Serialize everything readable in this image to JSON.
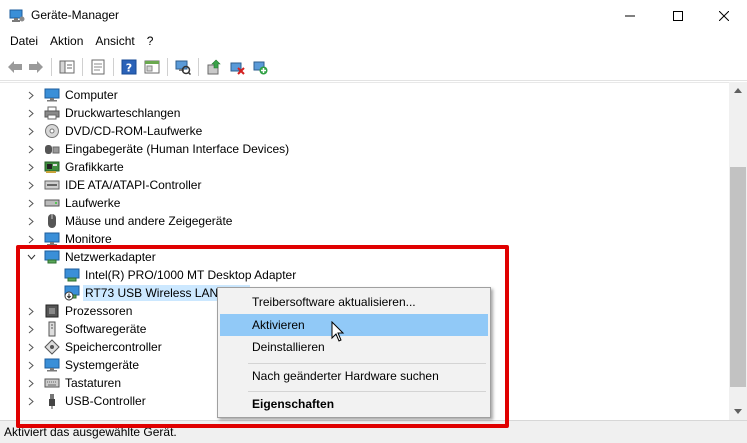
{
  "window": {
    "title": "Geräte-Manager",
    "icon": "device-manager-icon"
  },
  "menubar": {
    "items": [
      "Datei",
      "Aktion",
      "Ansicht",
      "?"
    ]
  },
  "toolbar": {
    "icons": [
      "back-arrow-icon",
      "forward-arrow-icon",
      "show-hide-icon",
      "properties-icon",
      "help-icon",
      "console-tree-icon",
      "scan-hardware-icon",
      "update-driver-icon",
      "uninstall-icon",
      "enable-device-icon"
    ]
  },
  "tree": {
    "items": [
      {
        "label": "Computer",
        "icon": "computer-icon",
        "expanded": false,
        "level": 0
      },
      {
        "label": "Druckwarteschlangen",
        "icon": "printer-icon",
        "expanded": false,
        "level": 0
      },
      {
        "label": "DVD/CD-ROM-Laufwerke",
        "icon": "dvd-icon",
        "expanded": false,
        "level": 0
      },
      {
        "label": "Eingabegeräte (Human Interface Devices)",
        "icon": "hid-icon",
        "expanded": false,
        "level": 0
      },
      {
        "label": "Grafikkarte",
        "icon": "graphics-card-icon",
        "expanded": false,
        "level": 0
      },
      {
        "label": "IDE ATA/ATAPI-Controller",
        "icon": "ide-controller-icon",
        "expanded": false,
        "level": 0
      },
      {
        "label": "Laufwerke",
        "icon": "disk-drive-icon",
        "expanded": false,
        "level": 0
      },
      {
        "label": "Mäuse und andere Zeigegeräte",
        "icon": "mouse-icon",
        "expanded": false,
        "level": 0
      },
      {
        "label": "Monitore",
        "icon": "monitor-icon",
        "expanded": false,
        "level": 0
      },
      {
        "label": "Netzwerkadapter",
        "icon": "network-adapter-icon",
        "expanded": true,
        "level": 0
      },
      {
        "label": "Intel(R) PRO/1000 MT Desktop Adapter",
        "icon": "network-adapter-icon",
        "level": 1
      },
      {
        "label": "RT73 USB Wireless LAN Card",
        "icon": "network-adapter-disabled-icon",
        "level": 1,
        "selected": true
      },
      {
        "label": "Prozessoren",
        "icon": "processor-icon",
        "expanded": false,
        "level": 0
      },
      {
        "label": "Softwaregeräte",
        "icon": "software-device-icon",
        "expanded": false,
        "level": 0
      },
      {
        "label": "Speichercontroller",
        "icon": "storage-controller-icon",
        "expanded": false,
        "level": 0
      },
      {
        "label": "Systemgeräte",
        "icon": "system-device-icon",
        "expanded": false,
        "level": 0
      },
      {
        "label": "Tastaturen",
        "icon": "keyboard-icon",
        "expanded": false,
        "level": 0
      },
      {
        "label": "USB-Controller",
        "icon": "usb-icon",
        "expanded": false,
        "level": 0
      }
    ]
  },
  "context_menu": {
    "items": [
      {
        "label": "Treibersoftware aktualisieren...",
        "hover": false,
        "bold": false
      },
      {
        "label": "Aktivieren",
        "hover": true,
        "bold": false
      },
      {
        "label": "Deinstallieren",
        "hover": false,
        "bold": false
      },
      {
        "label": "Nach geänderter Hardware suchen",
        "hover": false,
        "bold": false
      },
      {
        "label": "Eigenschaften",
        "hover": false,
        "bold": true
      }
    ]
  },
  "statusbar": {
    "text": "Aktiviert das ausgewählte Gerät."
  },
  "colors": {
    "highlight_border": "#e00000",
    "menu_hover": "#91c9f7",
    "selection": "#cce8ff",
    "menu_bg": "#f2f2f2"
  }
}
